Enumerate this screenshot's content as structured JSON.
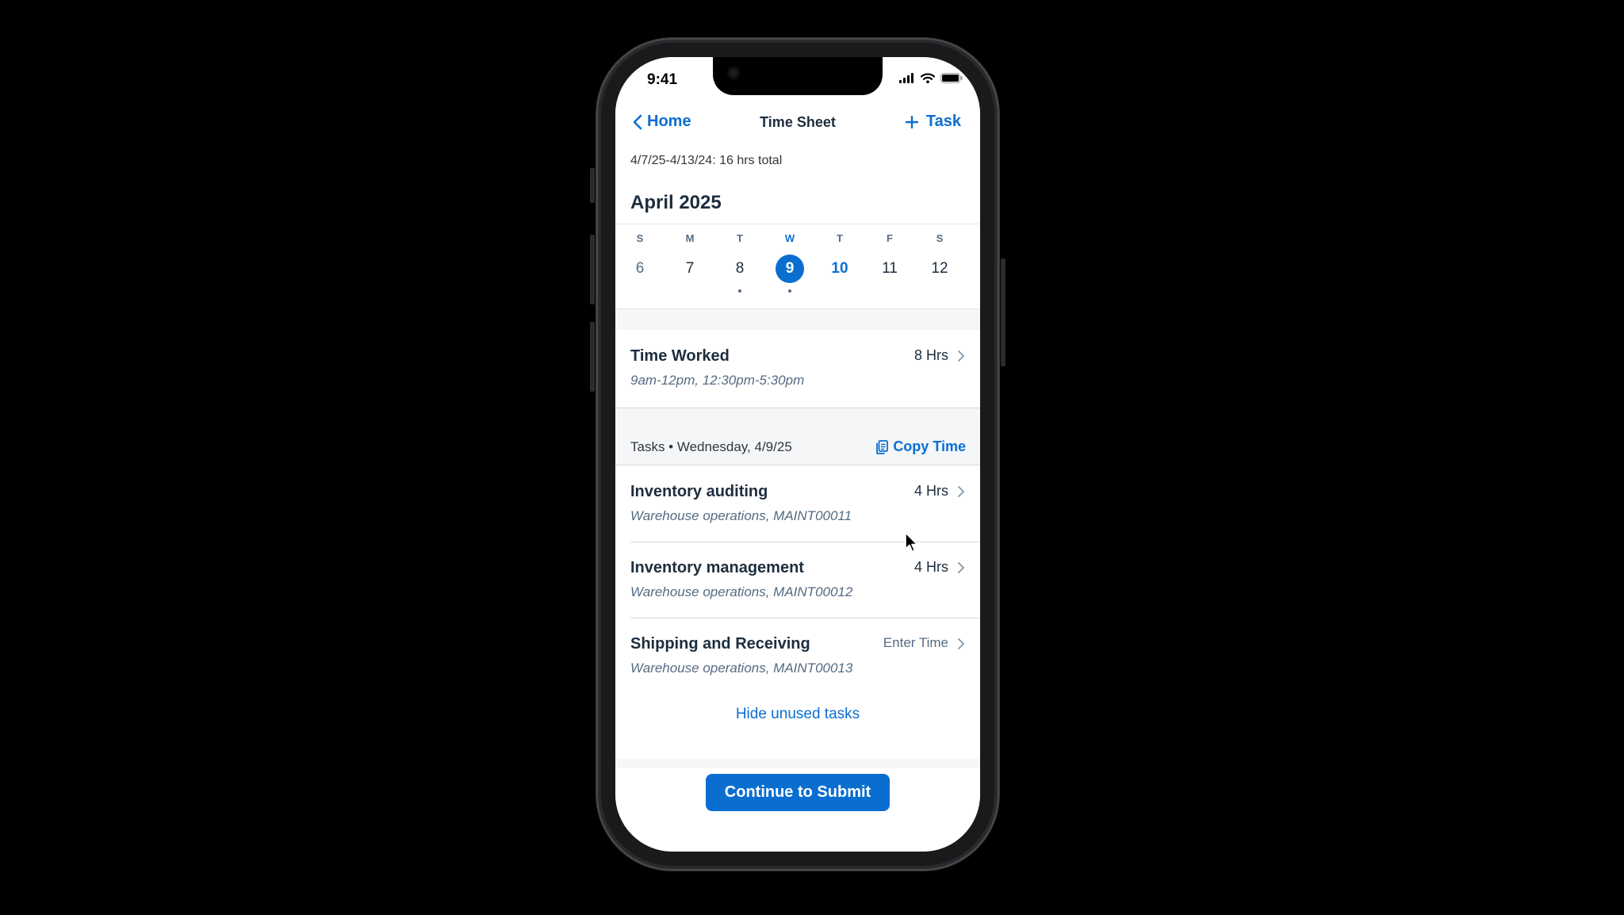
{
  "status_bar": {
    "time": "9:41"
  },
  "nav": {
    "back_label": "Home",
    "title": "Time Sheet",
    "add_label": "Task"
  },
  "summary": "4/7/25-4/13/24: 16 hrs total",
  "calendar": {
    "month": "April 2025",
    "weekdays": [
      "S",
      "M",
      "T",
      "W",
      "T",
      "F",
      "S"
    ],
    "days": [
      "6",
      "7",
      "8",
      "9",
      "10",
      "11",
      "12"
    ],
    "selected_day": "9",
    "today": "10"
  },
  "time_worked": {
    "title": "Time Worked",
    "hours": "8 Hrs",
    "subtitle": "9am-12pm, 12:30pm-5:30pm"
  },
  "tasks": {
    "header": "Tasks • Wednesday, 4/9/25",
    "copy_label": "Copy Time",
    "items": [
      {
        "title": "Inventory auditing",
        "subtitle": "Warehouse operations, MAINT00011",
        "value": "4 Hrs"
      },
      {
        "title": "Inventory management",
        "subtitle": "Warehouse operations, MAINT00012",
        "value": "4 Hrs"
      },
      {
        "title": "Shipping and Receiving",
        "subtitle": "Warehouse operations, MAINT00013",
        "value": "Enter Time"
      }
    ],
    "hide_label": "Hide unused tasks"
  },
  "submit_label": "Continue to Submit",
  "colors": {
    "accent": "#0a6ed1",
    "text": "#1d2d3e",
    "secondary": "#556b82"
  }
}
